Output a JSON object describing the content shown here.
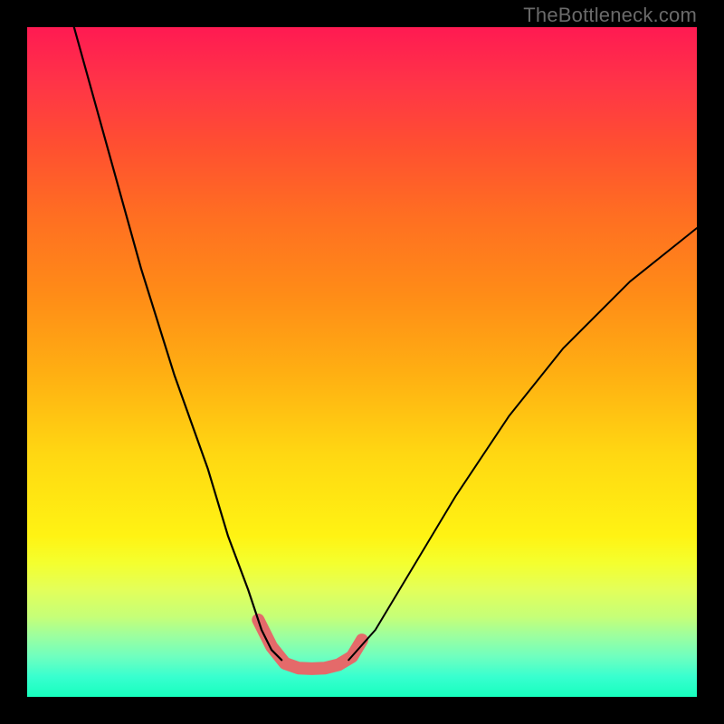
{
  "watermark": "TheBottleneck.com",
  "chart_data": {
    "type": "line",
    "title": "",
    "xlabel": "",
    "ylabel": "",
    "xlim": [
      0,
      100
    ],
    "ylim": [
      0,
      100
    ],
    "grid": false,
    "note": "No axes, ticks, or legend rendered; values are pixel-normalized (0–100) estimates of the plotted curves.",
    "series": [
      {
        "name": "left-descending-curve",
        "color": "#000000",
        "x": [
          7,
          12,
          17,
          22,
          27,
          30,
          33,
          35,
          36.5,
          38
        ],
        "y": [
          100,
          82,
          64,
          48,
          34,
          24,
          16,
          10,
          7,
          5.5
        ]
      },
      {
        "name": "right-ascending-curve",
        "color": "#000000",
        "x": [
          48,
          52,
          58,
          64,
          72,
          80,
          90,
          100
        ],
        "y": [
          5.5,
          10,
          20,
          30,
          42,
          52,
          62,
          70
        ]
      },
      {
        "name": "valley-highlight",
        "color": "#e46a6a",
        "stroke_width_px": 14,
        "x": [
          34.5,
          36.5,
          38.5,
          40.5,
          42.5,
          44.5,
          46.5,
          48.5,
          50.0
        ],
        "y": [
          11.5,
          7.5,
          5.0,
          4.3,
          4.2,
          4.3,
          4.8,
          6.0,
          8.5
        ]
      }
    ]
  }
}
